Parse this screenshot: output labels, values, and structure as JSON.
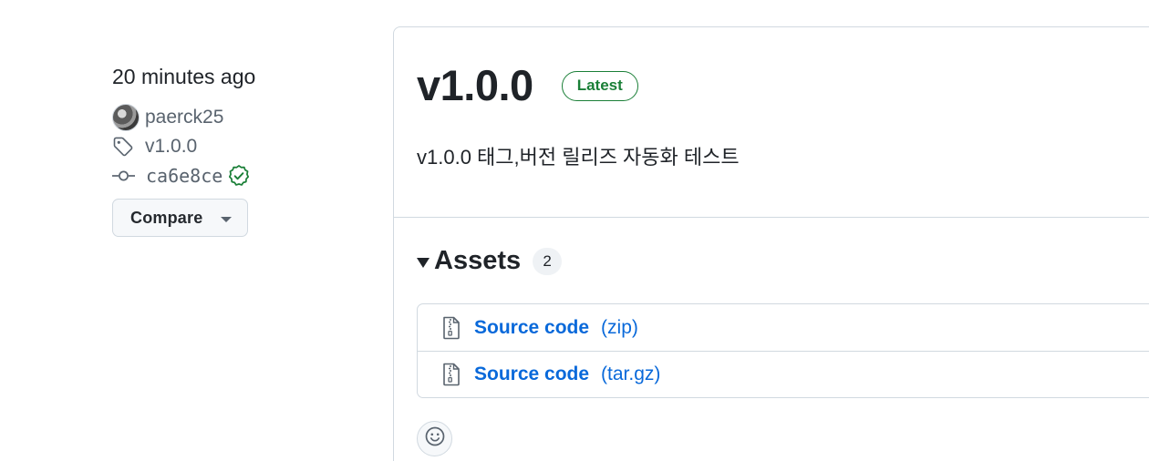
{
  "sidebar": {
    "time": "20 minutes ago",
    "author": "paerck25",
    "tag": "v1.0.0",
    "commit": "ca6e8ce",
    "compare_label": "Compare"
  },
  "release": {
    "title": "v1.0.0",
    "badge": "Latest",
    "body": "v1.0.0 태그,버전 릴리즈 자동화 테스트"
  },
  "assets": {
    "title": "Assets",
    "count": "2",
    "items": [
      {
        "name": "Source code",
        "ext": "(zip)"
      },
      {
        "name": "Source code",
        "ext": "(tar.gz)"
      }
    ]
  },
  "colors": {
    "link": "#0969da",
    "success": "#1a7f37",
    "muted": "#59636e",
    "border": "#d1d9e0"
  },
  "icons": {
    "tag": "tag-icon",
    "commit": "git-commit-icon",
    "verified": "verified-icon",
    "file_zip": "file-zip-icon",
    "smiley": "smiley-icon"
  }
}
